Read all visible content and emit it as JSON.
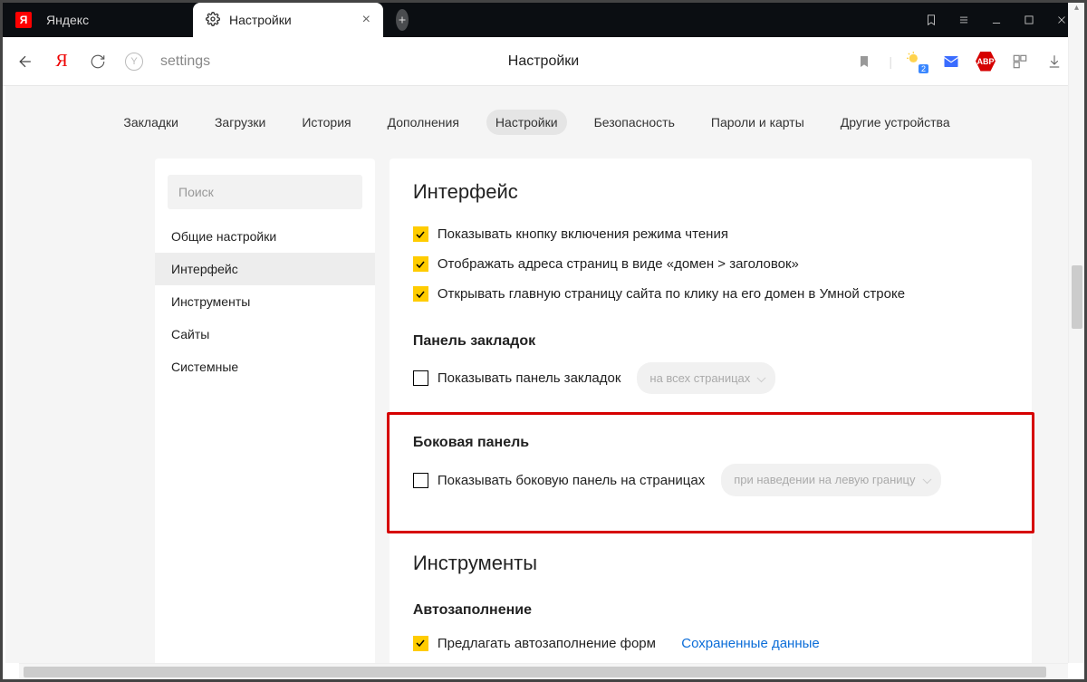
{
  "tabs": {
    "inactive_title": "Яндекс",
    "active_title": "Настройки"
  },
  "addressbar": {
    "url_text": "settings",
    "page_title": "Настройки"
  },
  "topnav": {
    "items": [
      "Закладки",
      "Загрузки",
      "История",
      "Дополнения",
      "Настройки",
      "Безопасность",
      "Пароли и карты",
      "Другие устройства"
    ],
    "active_index": 4
  },
  "sidebar": {
    "search_placeholder": "Поиск",
    "items": [
      "Общие настройки",
      "Интерфейс",
      "Инструменты",
      "Сайты",
      "Системные"
    ],
    "selected_index": 1
  },
  "settings": {
    "interface_heading": "Интерфейс",
    "opts": {
      "reader_button": "Показывать кнопку включения режима чтения",
      "domain_title": "Отображать адреса страниц в виде «домен > заголовок»",
      "smart_line": "Открывать главную страницу сайта по клику на его домен в Умной строке"
    },
    "bookmarks_heading": "Панель закладок",
    "bookmarks_show": "Показывать панель закладок",
    "bookmarks_select": "на всех страницах",
    "sidepanel_heading": "Боковая панель",
    "sidepanel_show": "Показывать боковую панель на страницах",
    "sidepanel_select": "при наведении на левую границу",
    "tools_heading": "Инструменты",
    "autofill_heading": "Автозаполнение",
    "autofill_offer": "Предлагать автозаполнение форм",
    "autofill_link": "Сохраненные данные"
  },
  "ext_badge": "2"
}
